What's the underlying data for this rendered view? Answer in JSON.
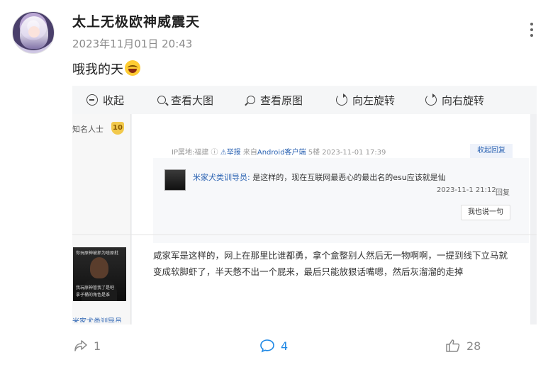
{
  "post": {
    "username": "太上无极欧神威震天",
    "timestamp": "2023年11月01日 20:43",
    "text": "哦我的天"
  },
  "toolbar": {
    "collapse": "收起",
    "zoom": "查看大图",
    "original": "查看原图",
    "rotate_left": "向左旋转",
    "rotate_right": "向右旋转"
  },
  "image": {
    "user_level_text": "知名人士",
    "user_level_badge": "10",
    "meta": {
      "ip": "IP属地:福建",
      "report": "举报",
      "from_prefix": "来自",
      "client": "Android客户端",
      "floor": "5楼",
      "time": "2023-11-01 17:39"
    },
    "collapse_reply": "收起回复",
    "subreply": {
      "user": "米家犬类训导员:",
      "text": "是这样的，现在互联网最恶心的最出名的esu应该就是仙",
      "time": "2023-11-1 21:12",
      "reply": "回复"
    },
    "say_button": "我也说一句",
    "left_image_caption_top": "你玩原神被抓为啥原批",
    "left_image_caption_mid": "我玩原神管我了是吧",
    "left_image_caption_bottom": "拿子桶的角色是谁",
    "left_name": "米家犬类训导员",
    "floor_text": "咸家军是这样的，网上在那里比谁都勇，拿个盒整别人然后无一物啊啊，一提到线下立马就变成软脚虾了，半天憋不出一个屁来，最后只能放狠话嘴嗯，然后灰溜溜的走掉"
  },
  "footer": {
    "share_count": "1",
    "comment_count": "4",
    "like_count": "28"
  },
  "colors": {
    "accent": "#1e88e5",
    "link": "#2d64b3",
    "muted": "#8a8a8a"
  }
}
